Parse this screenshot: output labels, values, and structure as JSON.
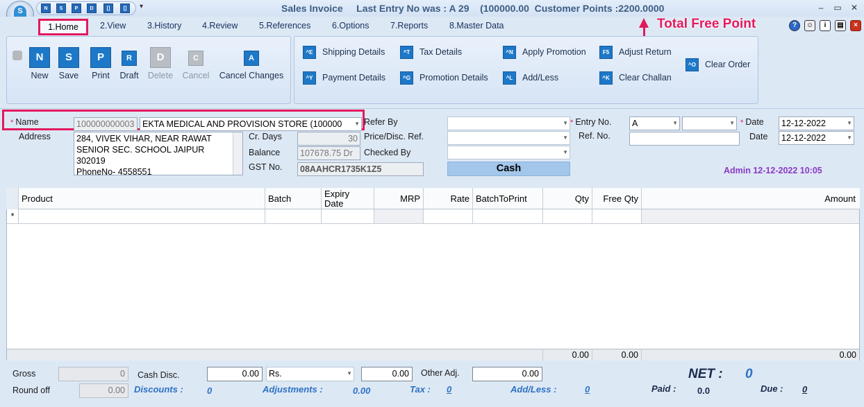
{
  "title_bar": {
    "text": "Sales Invoice     Last Entry No was : A 29    (100000.00  Customer Points :2200.0000",
    "quick_access_icons": [
      "N",
      "S",
      "P",
      "D",
      "[]",
      "[]"
    ]
  },
  "menu": {
    "tabs": [
      "1.Home",
      "2.View",
      "3.History",
      "4.Review",
      "5.References",
      "6.Options",
      "7.Reports",
      "8.Master Data"
    ]
  },
  "annotation": {
    "total_free_point": "Total Free Point"
  },
  "ribbon": {
    "main": [
      {
        "label": "New",
        "icon": "N"
      },
      {
        "label": "Save",
        "icon": "S"
      },
      {
        "label": "Print",
        "icon": "P"
      },
      {
        "label": "Draft",
        "icon": "R"
      },
      {
        "label": "Delete",
        "icon": "D"
      },
      {
        "label": "Cancel",
        "icon": "C"
      },
      {
        "label": "Cancel Changes",
        "icon": "A"
      }
    ],
    "details": [
      {
        "label": "Shipping Details",
        "icon": "^E"
      },
      {
        "label": "Tax Details",
        "icon": "^T"
      },
      {
        "label": "Apply Promotion",
        "icon": "^N"
      },
      {
        "label": "Adjust Return",
        "icon": "F5"
      },
      {
        "label": "Payment Details",
        "icon": "^Y"
      },
      {
        "label": "Promotion Details",
        "icon": "^G"
      },
      {
        "label": "Add/Less",
        "icon": "^L"
      },
      {
        "label": "Clear Challan",
        "icon": "^K"
      },
      {
        "label": "Clear Order",
        "icon": "^O"
      }
    ]
  },
  "form": {
    "name_label": "Name",
    "name_code": "100000000003",
    "name_value": "EKTA MEDICAL AND PROVISION STORE (100000",
    "address_label": "Address",
    "address_lines": [
      "284, VIVEK VIHAR, NEAR RAWAT",
      "SENIOR  SEC. SCHOOL JAIPUR",
      "302019",
      "PhoneNo- 4558551"
    ],
    "cr_days_label": "Cr. Days",
    "cr_days_value": "30",
    "balance_label": "Balance",
    "balance_value": "107678.75 Dr",
    "gst_label": "GST No.",
    "gst_value": "08AAHCR1735K1Z5",
    "refer_by_label": "Refer By",
    "price_disc_label": "Price/Disc. Ref.",
    "checked_by_label": "Checked By",
    "cash_label": "Cash",
    "entry_no_label": "Entry No.",
    "entry_no_value": "A",
    "ref_no_label": "Ref. No.",
    "date_label": "Date",
    "date_value": "12-12-2022",
    "date2_label": "Date",
    "date2_value": "12-12-2022",
    "admin_line": "Admin 12-12-2022 10:05"
  },
  "grid": {
    "columns": [
      "Product",
      "Batch",
      "Expiry Date",
      "MRP",
      "Rate",
      "BatchToPrint",
      "Qty",
      "Free Qty",
      "Amount"
    ],
    "new_row_marker": "*",
    "totals": {
      "qty": "0.00",
      "free_qty": "0.00",
      "amount": "0.00"
    }
  },
  "bottom": {
    "gross_label": "Gross",
    "gross_value": "0",
    "round_off_label": "Round off",
    "round_off_value": "0.00",
    "cash_disc_label": "Cash Disc.",
    "cash_disc_value": "0.00",
    "cash_disc_unit": "Rs.",
    "cash_disc_amount": "0.00",
    "other_adj_label": "Other Adj.",
    "other_adj_value": "0.00",
    "discounts_label": "Discounts :",
    "discounts_value": "0",
    "adjustments_label": "Adjustments :",
    "adjustments_value": "0.00",
    "tax_label": "Tax :",
    "tax_value": "0",
    "add_less_label": "Add/Less :",
    "add_less_value": "0",
    "net_label": "NET :",
    "net_value": "0",
    "paid_label": "Paid :",
    "paid_value": "0.0",
    "due_label": "Due :",
    "due_value": "0"
  },
  "colors": {
    "highlight": "#e3195d",
    "accent_blue": "#2c72c4",
    "admin_purple": "#8a38c4"
  }
}
